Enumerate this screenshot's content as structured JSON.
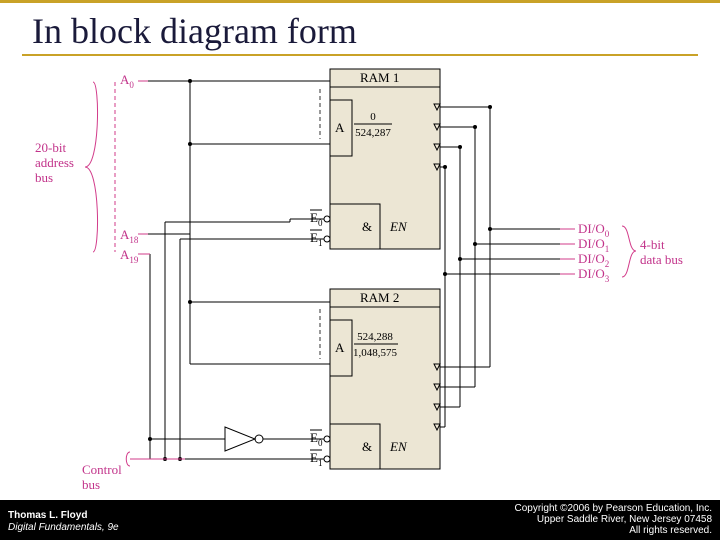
{
  "title": "In block diagram form",
  "footer": {
    "author": "Thomas L. Floyd",
    "book": "Digital Fundamentals, 9e",
    "copyright": "Copyright ©2006 by Pearson Education, Inc.",
    "addr": "Upper Saddle River, New Jersey 07458",
    "rights": "All rights reserved."
  },
  "labels": {
    "addr_a0": "A",
    "addr_a0_sub": "0",
    "addr_a18": "A",
    "addr_a18_sub": "18",
    "addr_a19": "A",
    "addr_a19_sub": "19",
    "addr_bus1": "20-bit",
    "addr_bus2": "address",
    "addr_bus3": "bus",
    "ctrl_bus1": "Control",
    "ctrl_bus2": "bus",
    "ram1": "RAM 1",
    "ram2": "RAM 2",
    "A": "A",
    "r1_top": "0",
    "r1_bot": "524,287",
    "r2_top": "524,288",
    "r2_bot": "1,048,575",
    "e0bar": "E",
    "e0sub": "0",
    "e1bar": "E",
    "e1sub": "1",
    "amp": "&",
    "en": "EN",
    "di0": "DI/O",
    "di0s": "0",
    "di1": "DI/O",
    "di1s": "1",
    "di2": "DI/O",
    "di2s": "2",
    "di3": "DI/O",
    "di3s": "3",
    "data1": "4-bit",
    "data2": "data bus"
  }
}
